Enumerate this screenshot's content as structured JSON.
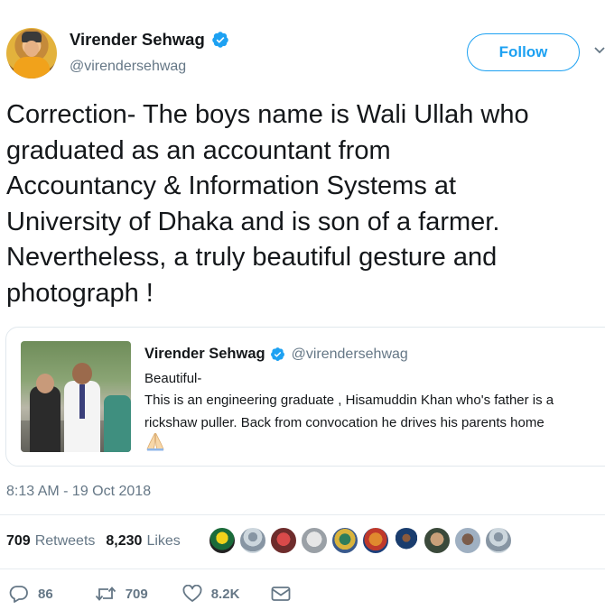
{
  "header": {
    "display_name": "Virender Sehwag",
    "handle": "@virendersehwag",
    "follow_label": "Follow",
    "avatar_icon": "user-avatar",
    "verified_icon": "verified-badge-icon"
  },
  "tweet": {
    "text": "Correction- The boys name is Wali Ullah who\ngraduated as an accountant from\nAccountancy & Information Systems at\nUniversity of Dhaka and is son of a farmer.\nNevertheless, a truly beautiful gesture and\nphotograph !"
  },
  "quoted_tweet": {
    "display_name": "Virender Sehwag",
    "handle": "@virendersehwag",
    "text": "Beautiful-\nThis is an engineering graduate , Hisamuddin Khan who's father is a\nrickshaw puller. Back from convocation he drives his parents home",
    "emoji": "🙏🏻",
    "image_icon": "photo-thumbnail"
  },
  "timestamp": "8:13 AM - 19 Oct 2018",
  "stats": {
    "retweets_count": "709",
    "retweets_label": "Retweets",
    "likes_count": "8,230",
    "likes_label": "Likes",
    "liker_avatar_count": 10
  },
  "actions": {
    "reply_count": "86",
    "retweet_count": "709",
    "like_count": "8.2K"
  },
  "colors": {
    "brand_blue": "#1da1f2",
    "secondary_text": "#657786",
    "border": "#e1e8ed"
  }
}
